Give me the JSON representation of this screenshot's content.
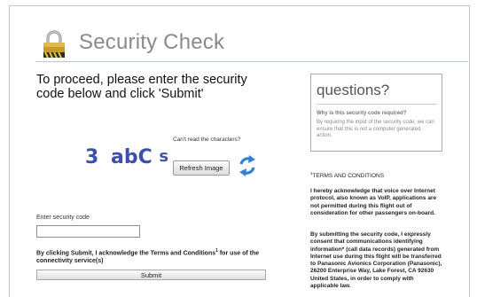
{
  "page": {
    "title": "Security Check",
    "instructions": "To proceed, please enter the security code below and click 'Submit'"
  },
  "captcha": {
    "characters": [
      "3",
      "ab",
      "C",
      "s"
    ],
    "cant_read_label": "Can't read the characters?",
    "refresh_label": "Refresh Image"
  },
  "form": {
    "code_label": "Enter security code",
    "code_value": "",
    "agreement_text": "By clicking Submit, I acknowledge the Terms and Conditions",
    "agreement_sup": "1",
    "agreement_tail": " for use of the connectivity service(s)",
    "submit_label": "Submit"
  },
  "questions": {
    "title": "questions?",
    "heading": "Why is this security code required?",
    "answer": "By requiring the input of the security code, we can ensure that this is not a computer generated action."
  },
  "terms": {
    "sup": "1",
    "heading": "TERMS AND CONDITIONS",
    "paragraph1": "I hereby acknowledge that voice over Internet protocol, also known as VoIP, applications are not permitted during this flight out of consideration for other passengers on-board.",
    "paragraph2": "By submitting the security code, I expressly consent that communications identifying information* (call data records) generated from Internet use during this flight will be transferred to Panasonic Avionics Corporation (Panasonic), 26200 Enterprise Way, Lake Forest, CA 92630 United States, in order to comply with applicable law."
  },
  "colors": {
    "captcha_text": "#3d4fa8",
    "refresh_icon": "#2f7fd6",
    "lock_gold": "#c99a2e",
    "title_gray": "#8a8a8a",
    "frame_border": "#b9c7d8"
  },
  "icons": {
    "lock": "lock-icon",
    "refresh": "refresh-icon"
  }
}
